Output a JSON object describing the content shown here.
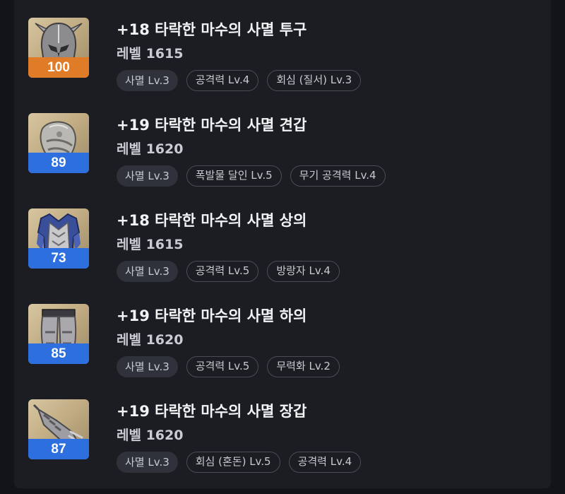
{
  "colors": {
    "quality_orange": "#e07b28",
    "quality_blue": "#2e6fe0"
  },
  "items": [
    {
      "icon": "helmet-icon",
      "quality": "100",
      "quality_color": "#e07b28",
      "name": "+18 타락한 마수의 사멸 투구",
      "level": "레벨 1615",
      "engravings": [
        "사멸 Lv.3",
        "공격력 Lv.4",
        "회심 (질서) Lv.3"
      ]
    },
    {
      "icon": "shoulder-armor-icon",
      "quality": "89",
      "quality_color": "#2e6fe0",
      "name": "+19 타락한 마수의 사멸 견갑",
      "level": "레벨 1620",
      "engravings": [
        "사멸 Lv.3",
        "폭발물 달인 Lv.5",
        "무기 공격력 Lv.4"
      ]
    },
    {
      "icon": "chest-armor-icon",
      "quality": "73",
      "quality_color": "#2e6fe0",
      "name": "+18 타락한 마수의 사멸 상의",
      "level": "레벨 1615",
      "engravings": [
        "사멸 Lv.3",
        "공격력 Lv.5",
        "방랑자 Lv.4"
      ]
    },
    {
      "icon": "leg-armor-icon",
      "quality": "85",
      "quality_color": "#2e6fe0",
      "name": "+19 타락한 마수의 사멸 하의",
      "level": "레벨 1620",
      "engravings": [
        "사멸 Lv.3",
        "공격력 Lv.5",
        "무력화 Lv.2"
      ]
    },
    {
      "icon": "gauntlet-icon",
      "quality": "87",
      "quality_color": "#2e6fe0",
      "name": "+19 타락한 마수의 사멸 장갑",
      "level": "레벨 1620",
      "engravings": [
        "사멸 Lv.3",
        "회심 (혼돈) Lv.5",
        "공격력 Lv.4"
      ]
    }
  ]
}
